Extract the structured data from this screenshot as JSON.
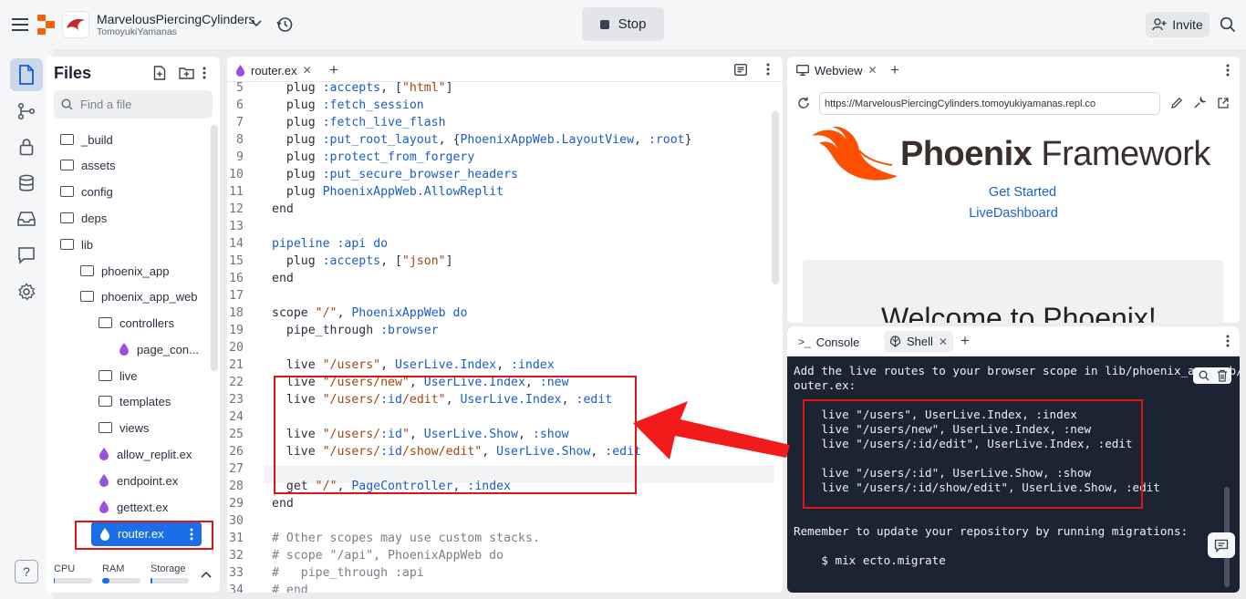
{
  "topbar": {
    "repl_name": "MarvelousPiercingCylinders",
    "repl_owner": "TomoyukiYamanas",
    "stop_label": "Stop",
    "invite_label": "Invite"
  },
  "files": {
    "title": "Files",
    "search_placeholder": "Find a file",
    "items": [
      {
        "label": "_build",
        "type": "folder"
      },
      {
        "label": "assets",
        "type": "folder"
      },
      {
        "label": "config",
        "type": "folder"
      },
      {
        "label": "deps",
        "type": "folder"
      },
      {
        "label": "lib",
        "type": "folder"
      },
      {
        "label": "phoenix_app",
        "type": "folder"
      },
      {
        "label": "phoenix_app_web",
        "type": "folder"
      },
      {
        "label": "controllers",
        "type": "folder"
      },
      {
        "label": "page_con...",
        "type": "elixir"
      },
      {
        "label": "live",
        "type": "folder"
      },
      {
        "label": "templates",
        "type": "folder"
      },
      {
        "label": "views",
        "type": "folder"
      },
      {
        "label": "allow_replit.ex",
        "type": "elixir"
      },
      {
        "label": "endpoint.ex",
        "type": "elixir"
      },
      {
        "label": "gettext.ex",
        "type": "elixir"
      },
      {
        "label": "router.ex",
        "type": "elixir"
      }
    ]
  },
  "resources": {
    "cpu": "CPU",
    "ram": "RAM",
    "storage": "Storage",
    "cpu_level": 0.02,
    "ram_level": 0.18,
    "storage_level": 0.05
  },
  "editor": {
    "tab_label": "router.ex",
    "lines": [
      {
        "n": "5",
        "t": "  plug :accepts, [\"html\"]"
      },
      {
        "n": "6",
        "t": "  plug :fetch_session"
      },
      {
        "n": "7",
        "t": "  plug :fetch_live_flash"
      },
      {
        "n": "8",
        "t": "  plug :put_root_layout, {PhoenixAppWeb.LayoutView, :root}"
      },
      {
        "n": "9",
        "t": "  plug :protect_from_forgery"
      },
      {
        "n": "10",
        "t": "  plug :put_secure_browser_headers"
      },
      {
        "n": "11",
        "t": "  plug PhoenixAppWeb.AllowReplit"
      },
      {
        "n": "12",
        "t": "end"
      },
      {
        "n": "13",
        "t": ""
      },
      {
        "n": "14",
        "t": "pipeline :api do"
      },
      {
        "n": "15",
        "t": "  plug :accepts, [\"json\"]"
      },
      {
        "n": "16",
        "t": "end"
      },
      {
        "n": "17",
        "t": ""
      },
      {
        "n": "18",
        "t": "scope \"/\", PhoenixAppWeb do"
      },
      {
        "n": "19",
        "t": "  pipe_through :browser"
      },
      {
        "n": "20",
        "t": ""
      },
      {
        "n": "21",
        "t": "  live \"/users\", UserLive.Index, :index"
      },
      {
        "n": "22",
        "t": "  live \"/users/new\", UserLive.Index, :new"
      },
      {
        "n": "23",
        "t": "  live \"/users/:id/edit\", UserLive.Index, :edit"
      },
      {
        "n": "24",
        "t": ""
      },
      {
        "n": "25",
        "t": "  live \"/users/:id\", UserLive.Show, :show"
      },
      {
        "n": "26",
        "t": "  live \"/users/:id/show/edit\", UserLive.Show, :edit"
      },
      {
        "n": "27",
        "t": ""
      },
      {
        "n": "28",
        "t": "  get \"/\", PageController, :index"
      },
      {
        "n": "29",
        "t": "end"
      },
      {
        "n": "30",
        "t": ""
      },
      {
        "n": "31",
        "t": "# Other scopes may use custom stacks."
      },
      {
        "n": "32",
        "t": "# scope \"/api\", PhoenixAppWeb do"
      },
      {
        "n": "33",
        "t": "#   pipe_through :api"
      },
      {
        "n": "34",
        "t": "# end"
      }
    ]
  },
  "webview": {
    "tab_label": "Webview",
    "url": "https://MarvelousPiercingCylinders.tomoyukiyamanas.repl.co",
    "brand_bold": "Phoenix",
    "brand_light": " Framework",
    "link1": "Get Started",
    "link2": "LiveDashboard",
    "welcome": "Welcome to Phoenix!"
  },
  "shell": {
    "console_tab": "Console",
    "shell_tab": "Shell",
    "lines": [
      "Add the live routes to your browser scope in lib/phoenix_app_web/r",
      "outer.ex:",
      "",
      "    live \"/users\", UserLive.Index, :index",
      "    live \"/users/new\", UserLive.Index, :new",
      "    live \"/users/:id/edit\", UserLive.Index, :edit",
      "",
      "    live \"/users/:id\", UserLive.Show, :show",
      "    live \"/users/:id/show/edit\", UserLive.Show, :edit",
      "",
      "",
      "Remember to update your repository by running migrations:",
      "",
      "    $ mix ecto.migrate"
    ]
  },
  "colors": {
    "accent": "#1a6ee8",
    "highlight": "#e01414",
    "elixir_drop": "#9b51e0",
    "phoenix_orange": "#fd4f00"
  }
}
